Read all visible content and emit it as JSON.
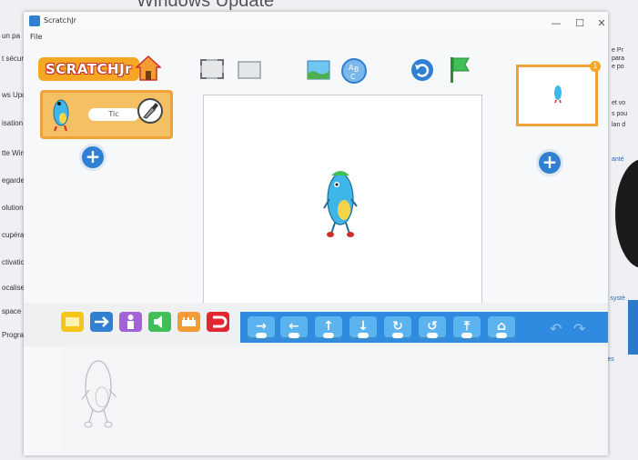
{
  "background_window": {
    "title": "Windows Update",
    "sidebar_items": [
      "un pa",
      "t sécur",
      "ws Upd",
      "isation d",
      "tte Windo",
      "egarde de",
      "olution des",
      "cupération",
      "ctivation",
      "ocaliser mon",
      "space dévelop",
      "Programme W"
    ],
    "right_texts": [
      "e Pr",
      "para",
      "e po",
      "et vo",
      "s pou",
      "lan d",
      "anté",
      "alité du systè",
      "mentaires"
    ]
  },
  "app": {
    "title": "ScratchJr",
    "menu_file": "File",
    "window_controls": [
      "—",
      "☐",
      "✕"
    ],
    "logo_text": "SCRATCHJr",
    "sprite": {
      "name": "Tic"
    },
    "page_number": "1",
    "colors": {
      "accent_orange": "#f5a623",
      "blocks_blue": "#2f8be0",
      "cat_yellow": "#f5c518",
      "cat_blue": "#2f7fd3",
      "cat_purple": "#a363d8",
      "cat_green": "#3fbf55",
      "cat_orange": "#f39c34",
      "cat_red": "#e3262f"
    },
    "categories": [
      "triggering",
      "motion",
      "looks",
      "sound",
      "control",
      "end"
    ],
    "motion_blocks": [
      {
        "icon": "move-right-icon",
        "glyph": "→"
      },
      {
        "icon": "move-left-icon",
        "glyph": "←"
      },
      {
        "icon": "move-up-icon",
        "glyph": "↑"
      },
      {
        "icon": "move-down-icon",
        "glyph": "↓"
      },
      {
        "icon": "turn-right-icon",
        "glyph": "↻"
      },
      {
        "icon": "turn-left-icon",
        "glyph": "↺"
      },
      {
        "icon": "hop-icon",
        "glyph": "⤒"
      },
      {
        "icon": "go-home-icon",
        "glyph": "⌂"
      }
    ]
  }
}
